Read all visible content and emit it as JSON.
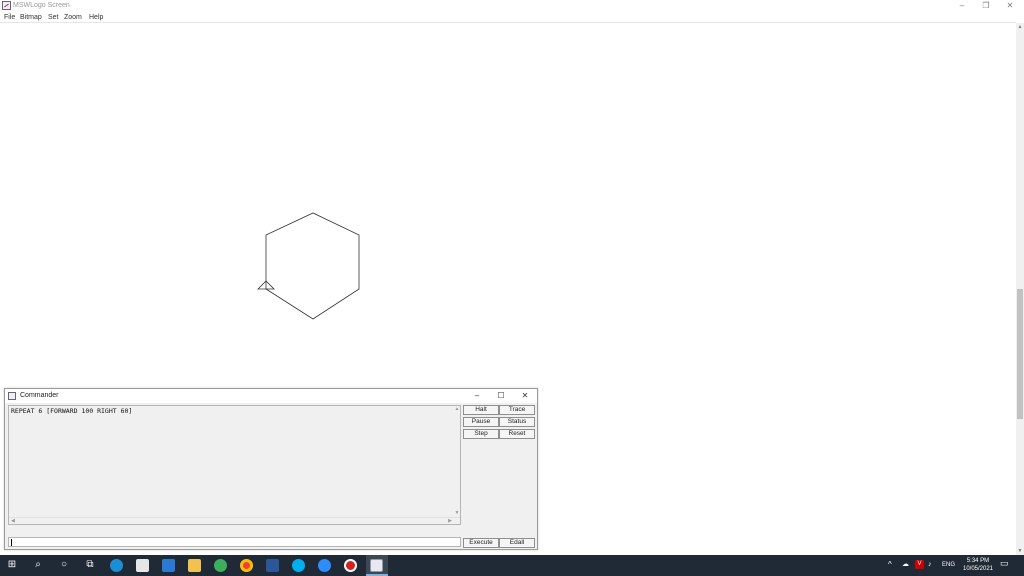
{
  "window": {
    "title": "MSWLogo Screen",
    "controls": {
      "minimize": "–",
      "restore": "❐",
      "close": "✕"
    }
  },
  "menu": [
    "File",
    "Bitmap",
    "Set",
    "Zoom",
    "Help"
  ],
  "commander": {
    "title": "Commander",
    "history": "REPEAT 6 [FORWARD 100 RIGHT 60]",
    "input_value": "",
    "buttons": {
      "halt": "Halt",
      "trace": "Trace",
      "pause": "Pause",
      "status": "Status",
      "step": "Step",
      "reset": "Reset",
      "execute": "Execute",
      "edall": "Edall"
    },
    "controls": {
      "minimize": "–",
      "maximize": "☐",
      "close": "✕"
    }
  },
  "taskbar": {
    "apps": [
      "start-icon",
      "search-icon",
      "cortana-icon",
      "task-view-icon",
      "edge-icon",
      "store-icon",
      "mail-icon",
      "file-explorer-icon",
      "app-icon",
      "chrome-icon",
      "word-icon",
      "skype-icon",
      "zoom-icon",
      "recorder-icon",
      "mswlogo-icon"
    ],
    "tray": {
      "language": "ENG",
      "time": "5:34 PM",
      "date": "10/05/2021"
    }
  }
}
